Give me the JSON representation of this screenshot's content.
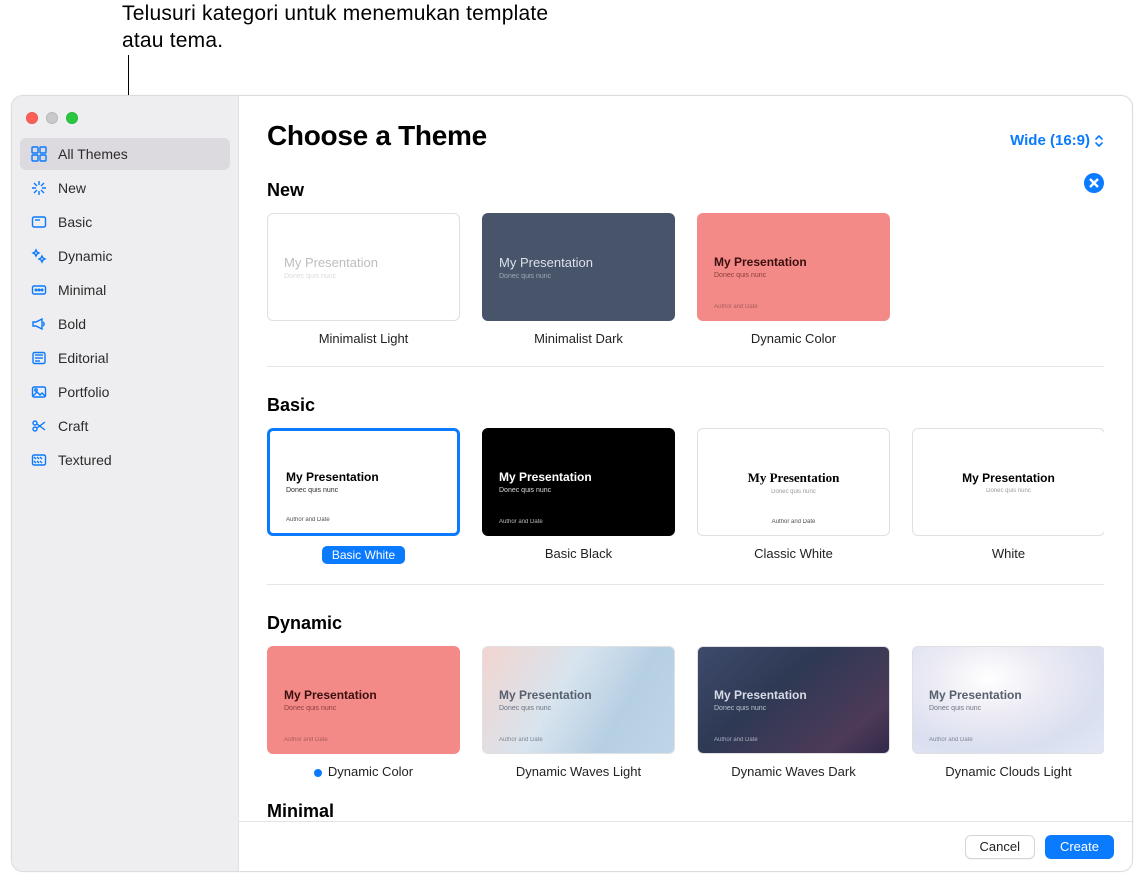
{
  "callout": "Telusuri kategori untuk menemukan template atau tema.",
  "header": {
    "title": "Choose a Theme",
    "aspect_label": "Wide (16:9)"
  },
  "sidebar": {
    "items": [
      {
        "id": "all",
        "label": "All Themes",
        "selected": true
      },
      {
        "id": "new",
        "label": "New",
        "selected": false
      },
      {
        "id": "basic",
        "label": "Basic",
        "selected": false
      },
      {
        "id": "dynamic",
        "label": "Dynamic",
        "selected": false
      },
      {
        "id": "minimal",
        "label": "Minimal",
        "selected": false
      },
      {
        "id": "bold",
        "label": "Bold",
        "selected": false
      },
      {
        "id": "editorial",
        "label": "Editorial",
        "selected": false
      },
      {
        "id": "portfolio",
        "label": "Portfolio",
        "selected": false
      },
      {
        "id": "craft",
        "label": "Craft",
        "selected": false
      },
      {
        "id": "textured",
        "label": "Textured",
        "selected": false
      }
    ]
  },
  "preview": {
    "title": "My Presentation",
    "subtitle": "Donec quis nunc",
    "footnote": "Author and Date"
  },
  "sections": {
    "new": {
      "title": "New",
      "themes": [
        {
          "label": "Minimalist Light",
          "variant": "min-light"
        },
        {
          "label": "Minimalist Dark",
          "variant": "min-dark"
        },
        {
          "label": "Dynamic Color",
          "variant": "dyn-color"
        }
      ]
    },
    "basic": {
      "title": "Basic",
      "themes": [
        {
          "label": "Basic White",
          "variant": "bw",
          "selected": true
        },
        {
          "label": "Basic Black",
          "variant": "bb"
        },
        {
          "label": "Classic White",
          "variant": "classic"
        },
        {
          "label": "White",
          "variant": "white2"
        }
      ]
    },
    "dynamic": {
      "title": "Dynamic",
      "themes": [
        {
          "label": "Dynamic Color",
          "variant": "dyn-color",
          "live": true
        },
        {
          "label": "Dynamic Waves Light",
          "variant": "waves-l"
        },
        {
          "label": "Dynamic Waves Dark",
          "variant": "waves-d"
        },
        {
          "label": "Dynamic Clouds Light",
          "variant": "clouds-l"
        }
      ]
    },
    "minimal": {
      "title": "Minimal"
    }
  },
  "footer": {
    "cancel": "Cancel",
    "create": "Create"
  },
  "colors": {
    "accent": "#0a7aff"
  }
}
